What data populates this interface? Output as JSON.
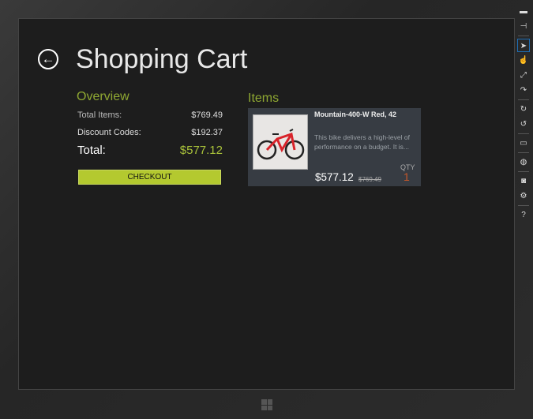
{
  "page": {
    "title": "Shopping Cart",
    "back_label": "←"
  },
  "overview": {
    "heading": "Overview",
    "total_items_label": "Total Items:",
    "total_items_value": "$769.49",
    "discount_label": "Discount Codes:",
    "discount_value": "$192.37",
    "total_label": "Total:",
    "total_value": "$577.12",
    "checkout_label": "CHECKOUT"
  },
  "items": {
    "heading": "Items",
    "list": [
      {
        "name": "Mountain-400-W Red, 42",
        "description": "This bike delivers a high-level of performance on a budget. It is...",
        "price": "$577.12",
        "original_price": "$769.49",
        "qty_label": "QTY",
        "qty": "1"
      }
    ]
  },
  "toolbar": {
    "icons": [
      "minimize-icon",
      "pin-icon",
      "pointer-icon",
      "touch-icon",
      "pinch-zoom-icon",
      "rotate-touch-icon",
      "rotate-clockwise-icon",
      "rotate-counterclockwise-icon",
      "resolution-icon",
      "location-icon",
      "screenshot-icon",
      "settings-icon",
      "help-icon"
    ],
    "help_label": "?"
  },
  "colors": {
    "accent": "#b4c92f",
    "qty": "#c8582a"
  }
}
